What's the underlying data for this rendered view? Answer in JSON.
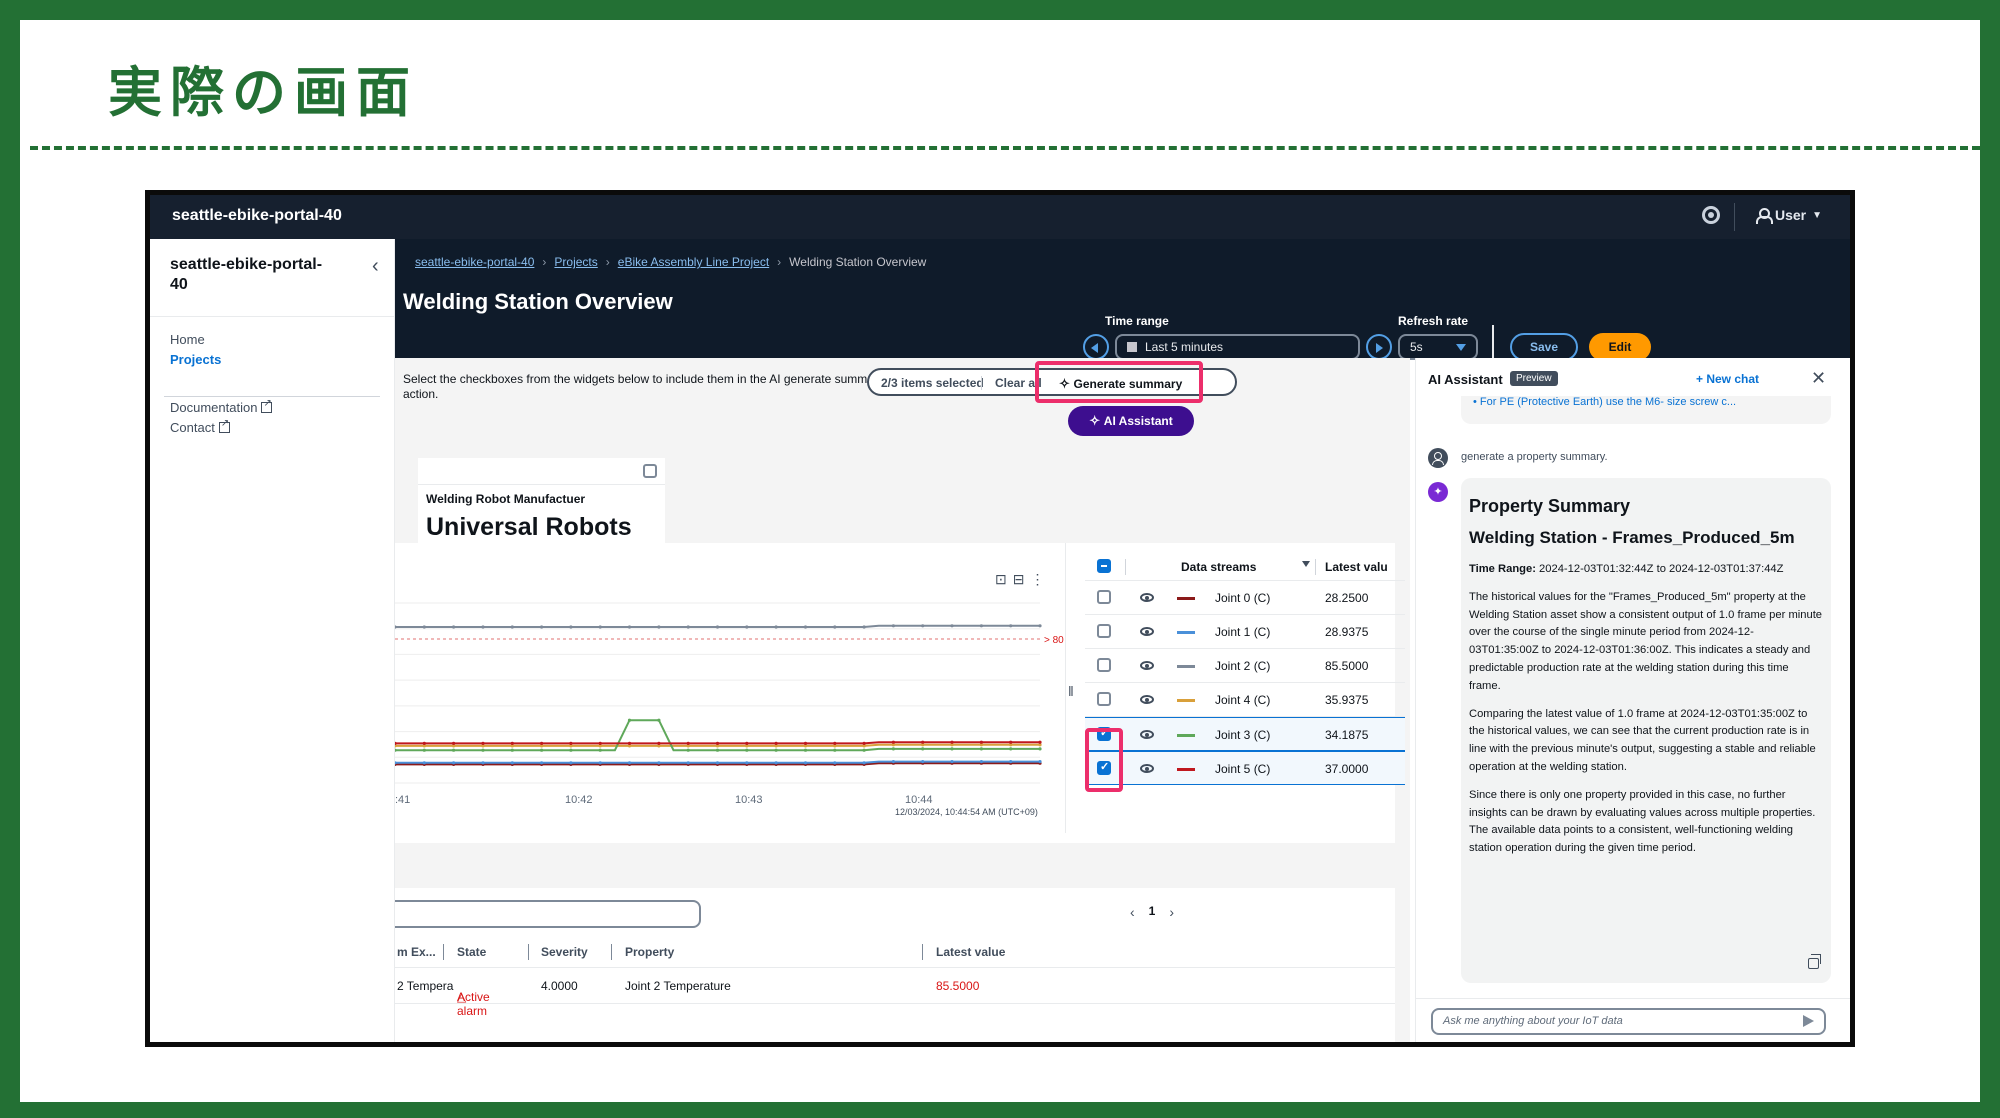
{
  "slide": {
    "title": "実際の画面"
  },
  "app": {
    "brand": "seattle-ebike-portal-40",
    "user_label": "User",
    "sidebar": {
      "title": "seattle-ebike-portal-40",
      "items": [
        {
          "label": "Home",
          "active": false
        },
        {
          "label": "Projects",
          "active": true
        }
      ],
      "links": [
        {
          "label": "Documentation"
        },
        {
          "label": "Contact"
        }
      ]
    },
    "breadcrumb": [
      "seattle-ebike-portal-40",
      "Projects",
      "eBike Assembly Line Project",
      "Welding Station Overview"
    ],
    "page_title": "Welding Station Overview",
    "time_range": {
      "label": "Time range",
      "value": "Last 5 minutes"
    },
    "refresh_rate": {
      "label": "Refresh rate",
      "value": "5s"
    },
    "save_label": "Save",
    "edit_label": "Edit",
    "hint": "Select the checkboxes from the widgets below to include them in the AI generate summary action.",
    "selection": {
      "count": "2/3 items selected",
      "clear": "Clear all",
      "generate": "Generate summary"
    },
    "ai_button": "AI Assistant",
    "kpi": {
      "label": "Welding Robot Manufactuer",
      "value": "Universal Robots"
    },
    "chart": {
      "x_ticks": [
        ":41",
        "10:42",
        "10:43",
        "10:44"
      ],
      "timestamp": "12/03/2024, 10:44:54 AM (UTC+09)",
      "threshold_label": "> 80",
      "legend_header": {
        "streams": "Data streams",
        "latest": "Latest valu"
      },
      "streams": [
        {
          "name": "Joint 0 (C)",
          "value": "28.2500",
          "color": "#8b1a1a",
          "checked": false
        },
        {
          "name": "Joint 1 (C)",
          "value": "28.9375",
          "color": "#4a90d9",
          "checked": false
        },
        {
          "name": "Joint 2 (C)",
          "value": "85.5000",
          "color": "#7d8998",
          "checked": false
        },
        {
          "name": "Joint 4 (C)",
          "value": "35.9375",
          "color": "#d9a03a",
          "checked": false
        },
        {
          "name": "Joint 3 (C)",
          "value": "34.1875",
          "color": "#5fa85a",
          "checked": true
        },
        {
          "name": "Joint 5 (C)",
          "value": "37.0000",
          "color": "#c0181e",
          "checked": true
        }
      ]
    },
    "alarms": {
      "page": "1",
      "headers": [
        "m Ex...",
        "State",
        "Severity",
        "Property",
        "Latest value"
      ],
      "rows": [
        {
          "name": "2 Tempera",
          "state": "Active alarm",
          "severity": "4.0000",
          "property": "Joint 2 Temperature",
          "latest": "85.5000"
        }
      ]
    },
    "assistant": {
      "title": "AI Assistant",
      "badge": "Preview",
      "new_chat": "New chat",
      "prev_link": "For PE (Protective Earth) use the M6- size screw c...",
      "user_message": "generate a property summary.",
      "response": {
        "heading": "Property Summary",
        "subheading": "Welding Station - Frames_Produced_5m",
        "time_range_label": "Time Range:",
        "time_range_value": " 2024-12-03T01:32:44Z to 2024-12-03T01:37:44Z",
        "paragraphs": [
          "The historical values for the \"Frames_Produced_5m\" property at the Welding Station asset show a consistent output of 1.0 frame per minute over the course of the single minute period from 2024-12-03T01:35:00Z to 2024-12-03T01:36:00Z. This indicates a steady and predictable production rate at the welding station during this time frame.",
          "Comparing the latest value of 1.0 frame at 2024-12-03T01:35:00Z to the historical values, we can see that the current production rate is in line with the previous minute's output, suggesting a stable and reliable operation at the welding station.",
          "Since there is only one property provided in this case, no further insights can be drawn by evaluating values across multiple properties. The available data points to a consistent, well-functioning welding station operation during the given time period."
        ]
      },
      "input_placeholder": "Ask me anything about your IoT data"
    }
  }
}
